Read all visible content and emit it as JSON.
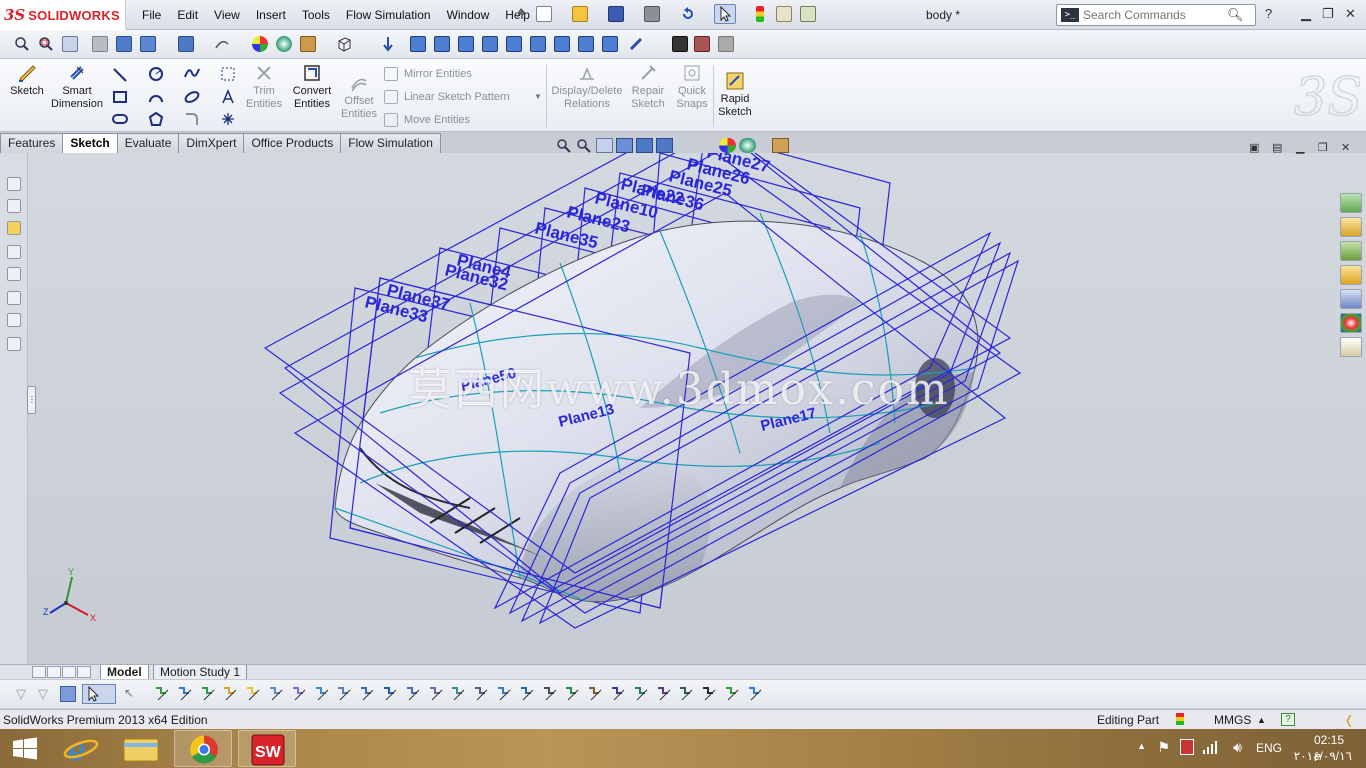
{
  "app": {
    "logo_mark": "3S",
    "logo_text": "SOLIDWORKS",
    "document_title": "body *",
    "menu": [
      "File",
      "Edit",
      "View",
      "Insert",
      "Tools",
      "Flow Simulation",
      "Window",
      "Help"
    ]
  },
  "search": {
    "placeholder": "Search Commands"
  },
  "command_manager": {
    "sketch": "Sketch",
    "smart_dimension": "Smart\nDimension",
    "trim_entities": "Trim\nEntities",
    "convert_entities": "Convert\nEntities",
    "offset_entities": "Offset\nEntities",
    "mirror_entities": "Mirror Entities",
    "linear_sketch_pattern": "Linear Sketch Pattern",
    "move_entities": "Move Entities",
    "display_delete_relations": "Display/Delete\nRelations",
    "repair_sketch": "Repair\nSketch",
    "quick_snaps": "Quick\nSnaps",
    "rapid_sketch": "Rapid\nSketch"
  },
  "tabs": [
    "Features",
    "Sketch",
    "Evaluate",
    "DimXpert",
    "Office Products",
    "Flow Simulation"
  ],
  "active_tab": "Sketch",
  "viewport": {
    "watermark": "莫西网www.3dmox.com",
    "planes": [
      {
        "label": "Plane27"
      },
      {
        "label": "Plane26"
      },
      {
        "label": "Plane25"
      },
      {
        "label": "Plane36"
      },
      {
        "label": "Plane22"
      },
      {
        "label": "Plane10"
      },
      {
        "label": "Plane23"
      },
      {
        "label": "Plane35"
      },
      {
        "label": "Plane4"
      },
      {
        "label": "Plane32"
      },
      {
        "label": "Plane37"
      },
      {
        "label": "Plane33"
      },
      {
        "label": "Plane50"
      },
      {
        "label": "Plane13"
      },
      {
        "label": "Plane17"
      }
    ],
    "axes": {
      "x": "X",
      "y": "Y",
      "z": "Z"
    }
  },
  "bottom_tabs": [
    "Model",
    "Motion Study 1"
  ],
  "active_bottom_tab": "Model",
  "status": {
    "edition": "SolidWorks Premium 2013 x64 Edition",
    "mode": "Editing Part",
    "units": "MMGS"
  },
  "taskbar": {
    "language": "ENG",
    "time": "02:15 م",
    "date": "٢٠١٤/٠٩/١٦"
  },
  "colors": {
    "accent_red": "#d8232a",
    "plane_blue": "#2a27d8",
    "curve_cyan": "#1aa0b8",
    "body_silver": "#dfe2ee"
  }
}
